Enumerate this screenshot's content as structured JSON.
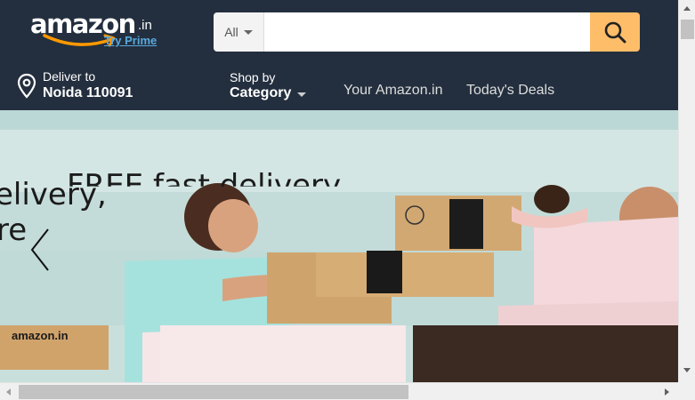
{
  "header": {
    "logo": {
      "wordmark": "amazon",
      "tld": ".in",
      "prime_link": "Try Prime"
    },
    "search": {
      "category": "All",
      "query": "",
      "placeholder": ""
    },
    "deliver": {
      "line1": "Deliver to",
      "line2": "Noida 110091"
    },
    "shop_by": {
      "line1": "Shop by",
      "line2": "Category"
    },
    "nav_links": [
      "Your Amazon.in",
      "Today's Deals"
    ]
  },
  "hero": {
    "headline_line1": "FREE fast delivery",
    "headline_line2": "elivery,",
    "headline_line3": "re",
    "box_brand": "amazon.in"
  },
  "icons": {
    "search": "search-icon",
    "location": "location-pin-icon",
    "prev": "chevron-left-icon"
  },
  "colors": {
    "header_bg": "#232f3e",
    "search_button": "#febd69",
    "prime_link": "#5aa9de",
    "hero_bg": "#c6dedc"
  }
}
